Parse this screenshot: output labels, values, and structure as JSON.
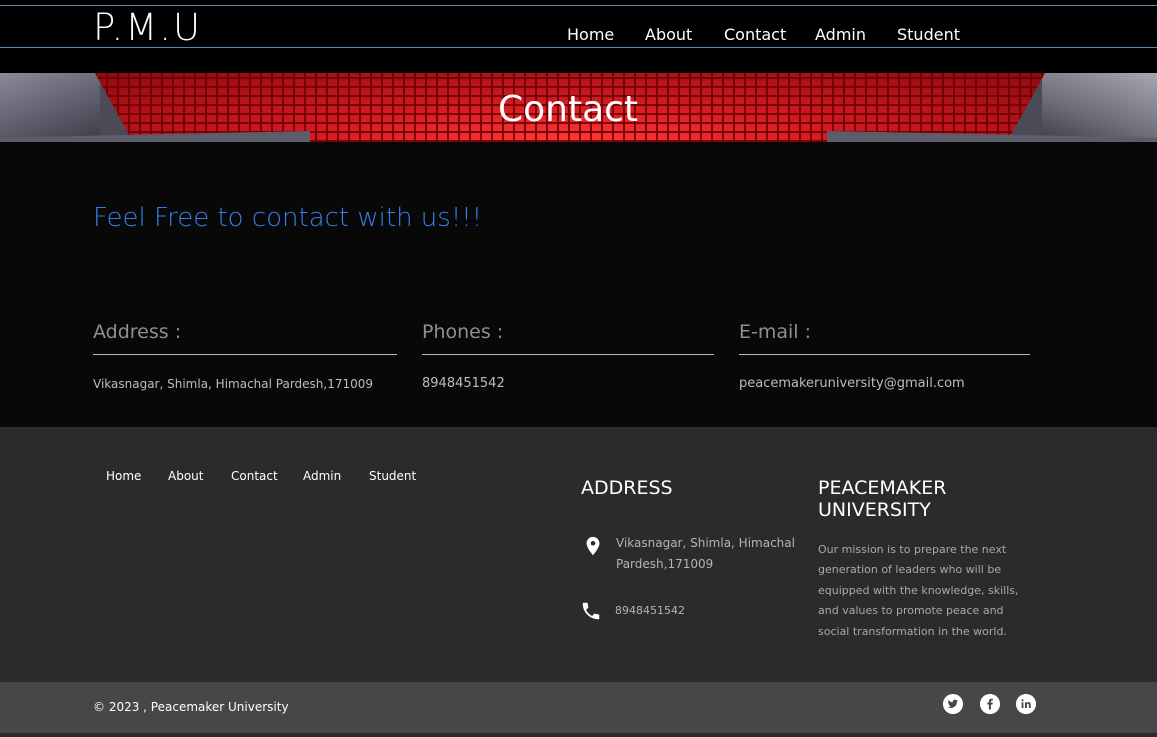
{
  "header": {
    "logo": "P.M.U",
    "nav": [
      "Home",
      "About",
      "Contact",
      "Admin",
      "Student"
    ]
  },
  "banner": {
    "title": "Contact"
  },
  "contact": {
    "tagline": "Feel Free to contact with us!!!",
    "address_label": "Address :",
    "address_value": "Vikasnagar, Shimla, Himachal Pardesh,171009",
    "phones_label": "Phones :",
    "phones_value": "8948451542",
    "email_label": "E-mail :",
    "email_value": "peacemakeruniversity@gmail.com"
  },
  "footer": {
    "nav": [
      "Home",
      "About",
      "Contact",
      "Admin",
      "Student"
    ],
    "address_heading": "ADDRESS",
    "address_line1": "Vikasnagar, Shimla, Himachal",
    "address_line2": "Pardesh,171009",
    "phone": "8948451542",
    "about_heading_line1": "PEACEMAKER",
    "about_heading_line2": "UNIVERSITY",
    "mission": "Our mission is to prepare the next generation of leaders who will be equipped with the knowledge, skills, and values to promote peace and social transformation in the world.",
    "icons": [
      "location-pin-icon",
      "phone-icon"
    ]
  },
  "bottom": {
    "copyright": "© 2023 , Peacemaker University",
    "social": [
      "twitter-icon",
      "facebook-icon",
      "linkedin-icon"
    ]
  }
}
